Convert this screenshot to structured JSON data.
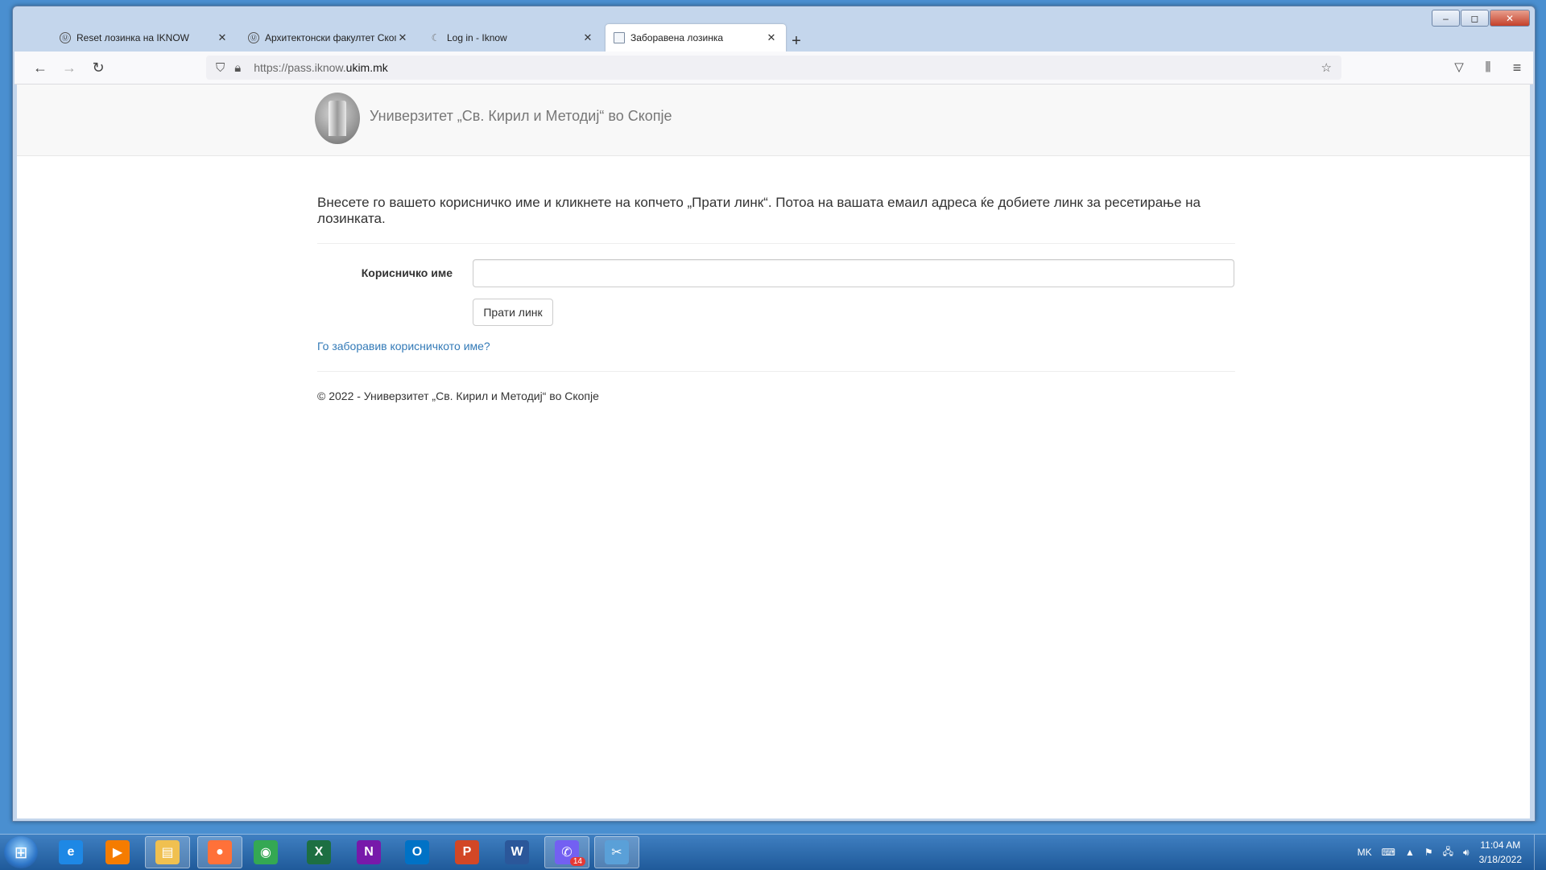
{
  "browser": {
    "tabs": [
      {
        "title": "Reset лозинка на IKNOW",
        "icon": "ukim-logo-icon"
      },
      {
        "title": "Архитектонски факултет Скопје",
        "icon": "ukim-logo-icon"
      },
      {
        "title": "Log in - Iknow",
        "icon": "moon-icon"
      },
      {
        "title": "Заборавена лозинка",
        "icon": "page-icon"
      }
    ],
    "url_prefix": "https://pass.iknow.",
    "url_domain": "ukim.mk"
  },
  "page": {
    "brand": "Универзитет „Св. Кирил и Методиј“ во Скопје",
    "intro": "Внесете го вашето корисничко име и кликнете на копчето „Прати линк“. Потоа на вашата емаил адреса ќе добиете линк за ресетирање на лозинката.",
    "username_label": "Корисничко име",
    "username_value": "",
    "send_button": "Прати линк",
    "forgot_link": "Го заборавив корисничкото име?",
    "footer": "© 2022 - Универзитет „Св. Кирил и Методиј“ во Скопје"
  },
  "taskbar": {
    "apps": [
      {
        "name": "internet-explorer",
        "label": "e",
        "color": "#1e88e5"
      },
      {
        "name": "media-player",
        "label": "▶",
        "color": "#f57c00"
      },
      {
        "name": "file-explorer",
        "label": "▤",
        "color": "#f0c050"
      },
      {
        "name": "firefox",
        "label": "●",
        "color": "#ff7139"
      },
      {
        "name": "chrome",
        "label": "◉",
        "color": "#34a853"
      },
      {
        "name": "excel",
        "label": "X",
        "color": "#1d6f42"
      },
      {
        "name": "onenote",
        "label": "N",
        "color": "#7719aa"
      },
      {
        "name": "outlook",
        "label": "O",
        "color": "#0072c6"
      },
      {
        "name": "powerpoint",
        "label": "P",
        "color": "#d24726"
      },
      {
        "name": "word",
        "label": "W",
        "color": "#2b579a"
      },
      {
        "name": "viber",
        "label": "✆",
        "color": "#7360f2"
      },
      {
        "name": "snipping-tool",
        "label": "✂",
        "color": "#5aa0d8"
      }
    ],
    "viber_badge": "14",
    "language": "MK",
    "time": "11:04 AM",
    "date": "3/18/2022"
  }
}
